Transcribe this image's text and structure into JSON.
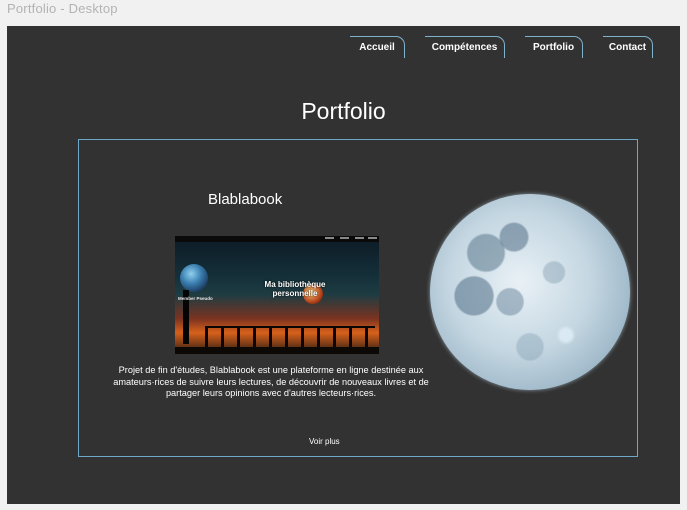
{
  "frame": {
    "title": "Portfolio - Desktop"
  },
  "nav": {
    "items": [
      {
        "label": "Accueil"
      },
      {
        "label": "Compétences"
      },
      {
        "label": "Portfolio"
      },
      {
        "label": "Contact"
      }
    ]
  },
  "page": {
    "title": "Portfolio"
  },
  "project": {
    "title": "Blablabook",
    "screenshot": {
      "hero_text": "Ma bibliothèque personnelle",
      "member_label": "Member Pseudo"
    },
    "description": "Projet de fin d'études, Blablabook est une plateforme en ligne destinée aux amateurs·rices de suivre leurs lectures, de découvrir de nouveaux livres et de partager leurs opinions avec d'autres lecteurs·rices.",
    "more_label": "Voir plus"
  },
  "colors": {
    "background": "#323232",
    "accent": "#6ea8c8",
    "text": "#ffffff"
  }
}
